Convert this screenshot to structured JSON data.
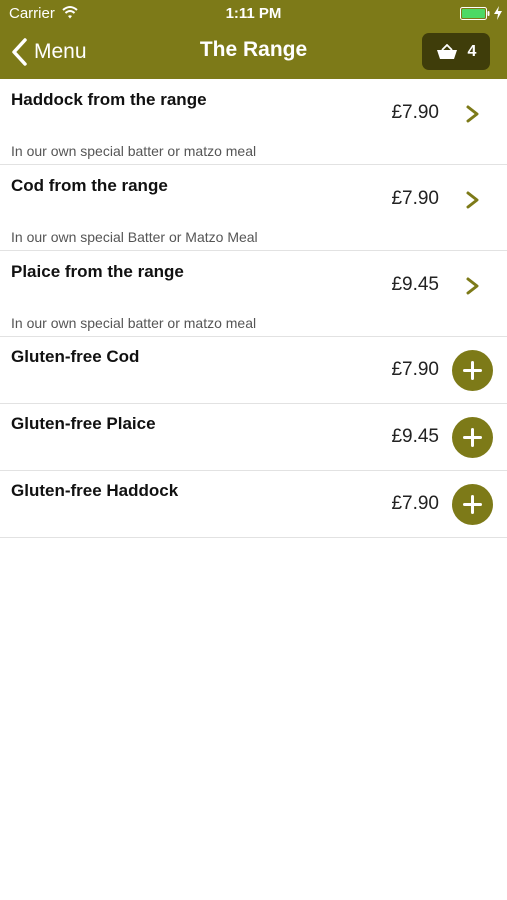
{
  "status_bar": {
    "carrier": "Carrier",
    "time": "1:11 PM"
  },
  "nav": {
    "back_label": "Menu",
    "title": "The Range",
    "basket_count": "4"
  },
  "items": [
    {
      "name": "Haddock from the range",
      "price": "£7.90",
      "description": "In our own special batter or matzo meal",
      "action": "chevron-right-icon"
    },
    {
      "name": "Cod from the range",
      "price": "£7.90",
      "description": "In our own special Batter or Matzo Meal",
      "action": "chevron-right-icon"
    },
    {
      "name": "Plaice from the range",
      "price": "£9.45",
      "description": "In our own special batter or matzo meal",
      "action": "chevron-right-icon"
    },
    {
      "name": "Gluten-free Cod",
      "price": "£7.90",
      "action": "plus-icon"
    },
    {
      "name": "Gluten-free Plaice",
      "price": "£9.45",
      "action": "plus-icon"
    },
    {
      "name": "Gluten-free Haddock",
      "price": "£7.90",
      "action": "plus-icon"
    }
  ],
  "colors": {
    "brand": "#7d7a18",
    "basket_bg": "#3f3d0a",
    "battery": "#4cd964"
  }
}
